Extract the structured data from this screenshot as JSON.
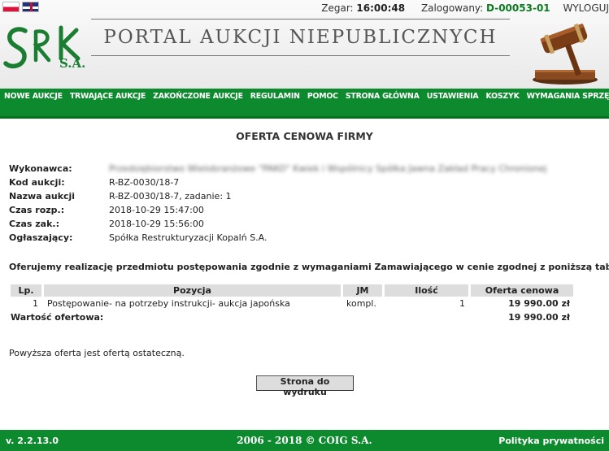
{
  "top": {
    "clock_label": "Zegar:",
    "clock_value": "16:00:48",
    "logged_label": "Zalogowany:",
    "logged_value": "D-00053-01",
    "logout_label": "WYLOGUJ"
  },
  "logo": {
    "sa": "S.A."
  },
  "banner": {
    "title": "PORTAL AUKCJI NIEPUBLICZNYCH"
  },
  "nav": {
    "items": [
      "NOWE AUKCJE",
      "TRWAJĄCE AUKCJE",
      "ZAKOŃCZONE AUKCJE",
      "REGULAMIN",
      "POMOC",
      "STRONA GŁÓWNA",
      "USTAWIENIA",
      "KOSZYK",
      "WYMAGANIA SPRZĘTOWE"
    ]
  },
  "page": {
    "title": "OFERTA CENOWA FIRMY"
  },
  "info": {
    "contractor_label": "Wykonawca:",
    "contractor_value": "Przedsiębiorstwo Wielobranżowe \"PAKO\" Kwiek i Wspólnicy Spółka Jawna Zakład Pracy Chronionej",
    "code_label": "Kod aukcji:",
    "code_value": "R-BZ-0030/18-7",
    "name_label": "Nazwa aukcji",
    "name_value": "R-BZ-0030/18-7, zadanie: 1",
    "start_label": "Czas rozp.:",
    "start_value": "2018-10-29 15:47:00",
    "end_label": "Czas zak.:",
    "end_value": "2018-10-29 15:56:00",
    "announcer_label": "Ogłaszający:",
    "announcer_value": "Spółka Restrukturyzacji Kopalń S.A."
  },
  "intro": "Oferujemy realizację przedmiotu postępowania zgodnie z wymaganiami Zamawiającego w cenie zgodnej z poniższą tabelą:",
  "table": {
    "headers": {
      "lp": "Lp.",
      "pos": "Pozycja",
      "jm": "JM",
      "qty": "Ilość",
      "price": "Oferta cenowa"
    },
    "row": {
      "lp": "1",
      "pos": "Postępowanie- na potrzeby instrukcji- aukcja japońska",
      "jm": "kompl.",
      "qty": "1",
      "price": "19 990.00 zł"
    },
    "sum_label": "Wartość ofertowa:",
    "sum_value": "19 990.00 zł"
  },
  "final_note": "Powyższa oferta jest ofertą ostateczną.",
  "print_button": "Strona do wydruku",
  "footer": {
    "version": "v. 2.2.13.0",
    "copyright": "2006 - 2018 © COIG S.A.",
    "privacy": "Polityka prywatności"
  },
  "colors": {
    "brand_green": "#0d8a2e",
    "user_green": "#0b7a1f"
  }
}
